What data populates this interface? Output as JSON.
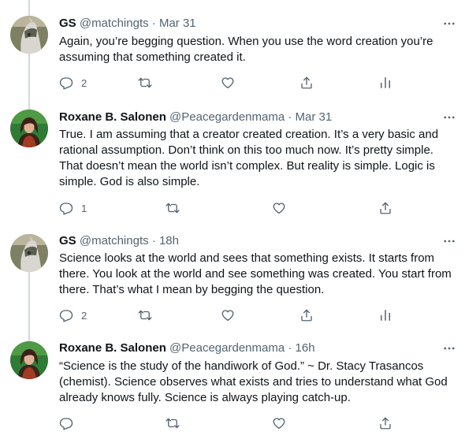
{
  "tweets": [
    {
      "name": "GS",
      "handle": "@matchingts",
      "dot": "·",
      "time": "Mar 31",
      "text": "Again, you’re begging question. When you use the word creation you’re assuming that something created it.",
      "reply_count": "2",
      "avatar": "horse-photo"
    },
    {
      "name": "Roxane B. Salonen",
      "handle": "@Peacegardenmama",
      "dot": "·",
      "time": "Mar 31",
      "text": "True. I am assuming that a creator created creation. It’s a very basic and rational assumption. Don’t think on this too much now. It’s pretty simple. That doesn’t mean the world isn’t complex. But reality is simple. Logic is simple. God is also simple.",
      "reply_count": "1",
      "avatar": "woman-photo"
    },
    {
      "name": "GS",
      "handle": "@matchingts",
      "dot": "·",
      "time": "18h",
      "text": "Science looks at the world and sees that something exists. It starts from there. You look at the world and see something was created. You start from there. That’s what I mean by begging the question.",
      "reply_count": "2",
      "avatar": "horse-photo"
    },
    {
      "name": "Roxane B. Salonen",
      "handle": "@Peacegardenmama",
      "dot": "·",
      "time": "16h",
      "text": "“Science is the study of the handiwork of God.” ~ Dr. Stacy Trasancos (chemist). Science observes what exists and tries to understand what God already knows fully. Science is always playing catch-up.",
      "reply_count": "",
      "avatar": "woman-photo"
    }
  ],
  "colors": {
    "text": "#0f1419",
    "secondary": "#536471",
    "thread_line": "#cfd9de"
  },
  "icons": [
    "reply-icon",
    "retweet-icon",
    "like-icon",
    "share-icon",
    "analytics-icon",
    "more-icon"
  ]
}
